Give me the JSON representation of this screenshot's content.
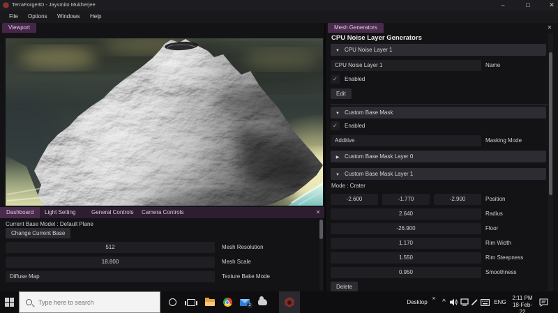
{
  "colors": {
    "accent_purple": "#4a2a4d",
    "tab_bar_purple": "#2e1c31",
    "panel_bg": "#131316",
    "field_bg": "#1e1e23",
    "header_bg": "#2c2c32",
    "taskbar_bg": "#0e0e10",
    "terraforge_icon_red": "#8a3330"
  },
  "icons": {
    "collapse_open": "▼",
    "collapse_closed": "▶",
    "check": "✓",
    "close": "✕",
    "minimize": "–",
    "maximize": "□",
    "dropdown_arrow": "▼",
    "overflow": "»",
    "tray_chevron": "^"
  },
  "titlebar": {
    "title": "TerraForge3D - Jaysmito Mukherjee"
  },
  "menubar": {
    "items": [
      "File",
      "Options",
      "Windows",
      "Help"
    ]
  },
  "viewport_window": {
    "tab": "Viewport"
  },
  "mesh_panel": {
    "tab": "Mesh Generators",
    "title": "CPU Noise Layer Generators",
    "noise_layer_header": "CPU Noise Layer 1",
    "name_value": "CPU Noise Layer 1",
    "name_label": "Name",
    "enabled_label": "Enabled",
    "edit_button": "Edit",
    "mask_header": "Custom Base Mask",
    "mask_enabled_label": "Enabled",
    "masking_mode_value": "Additive",
    "masking_mode_label": "Masking Mode",
    "mask_layer0_header": "Custom Base Mask Layer 0",
    "mask_layer1_header": "Custom Base Mask Layer 1",
    "mode_text": "Mode : Crater",
    "position": {
      "label": "Position",
      "x": "-2.600",
      "y": "-1.770",
      "z": "-2.900"
    },
    "radius": {
      "label": "Radius",
      "value": "2.640"
    },
    "floor": {
      "label": "Floor",
      "value": "-26.900"
    },
    "rim_width": {
      "label": "Rim Width",
      "value": "1.170"
    },
    "rim_steepness": {
      "label": "Rim Steepness",
      "value": "1.550"
    },
    "smoothness": {
      "label": "Smoothness",
      "value": "0.950"
    },
    "delete_button": "Delete"
  },
  "dashboard_panel": {
    "tabs": [
      "Dashboard",
      "Light Setting",
      "General Controls",
      "Camera Controls"
    ],
    "active_tab": "Dashboard",
    "current_base_text": "Current Base Model : Default Plane",
    "change_base_button": "Change Current Base",
    "mesh_resolution": {
      "value": "512",
      "label": "Mesh Resolution"
    },
    "mesh_scale": {
      "value": "18.800",
      "label": "Mesh Scale"
    },
    "texture_bake_mode": {
      "value": "Diffuse Map",
      "label": "Texture Bake Mode"
    }
  },
  "taskbar": {
    "search_placeholder": "Type here to search",
    "mail_badge": "2",
    "tray": {
      "desktop_label": "Desktop",
      "language": "ENG",
      "time": "2:11 PM",
      "date": "18-Feb-22"
    }
  }
}
